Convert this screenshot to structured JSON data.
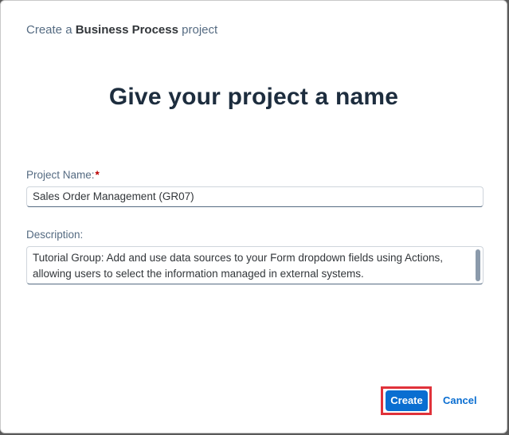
{
  "dialog": {
    "header_prefix": "Create a",
    "header_strong": "Business Process",
    "header_suffix": "project",
    "title": "Give your project a name"
  },
  "form": {
    "project_name_label": "Project Name:",
    "required_marker": "*",
    "project_name_value": "Sales Order Management (GR07)",
    "description_label": "Description:",
    "description_value": "Tutorial Group: Add and use data sources to your Form dropdown fields using Actions, allowing users to select the information managed in external systems."
  },
  "actions": {
    "create_label": "Create",
    "cancel_label": "Cancel"
  },
  "colors": {
    "accent": "#0a6ed1",
    "highlight": "#e0323a",
    "required": "#bb0000"
  }
}
